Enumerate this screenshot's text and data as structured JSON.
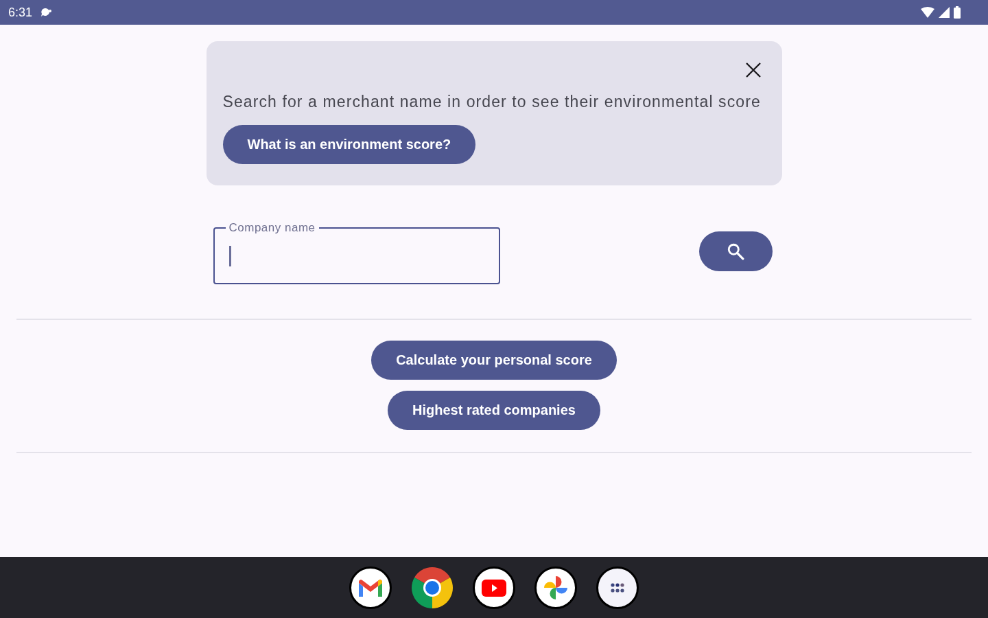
{
  "status_bar": {
    "time": "6:31"
  },
  "info_card": {
    "message": "Search for a merchant name in order to see their environmental score",
    "button": "What is an environment score?"
  },
  "search": {
    "label": "Company name",
    "focused": true
  },
  "actions": [
    "Calculate your personal score",
    "Highest rated companies"
  ]
}
